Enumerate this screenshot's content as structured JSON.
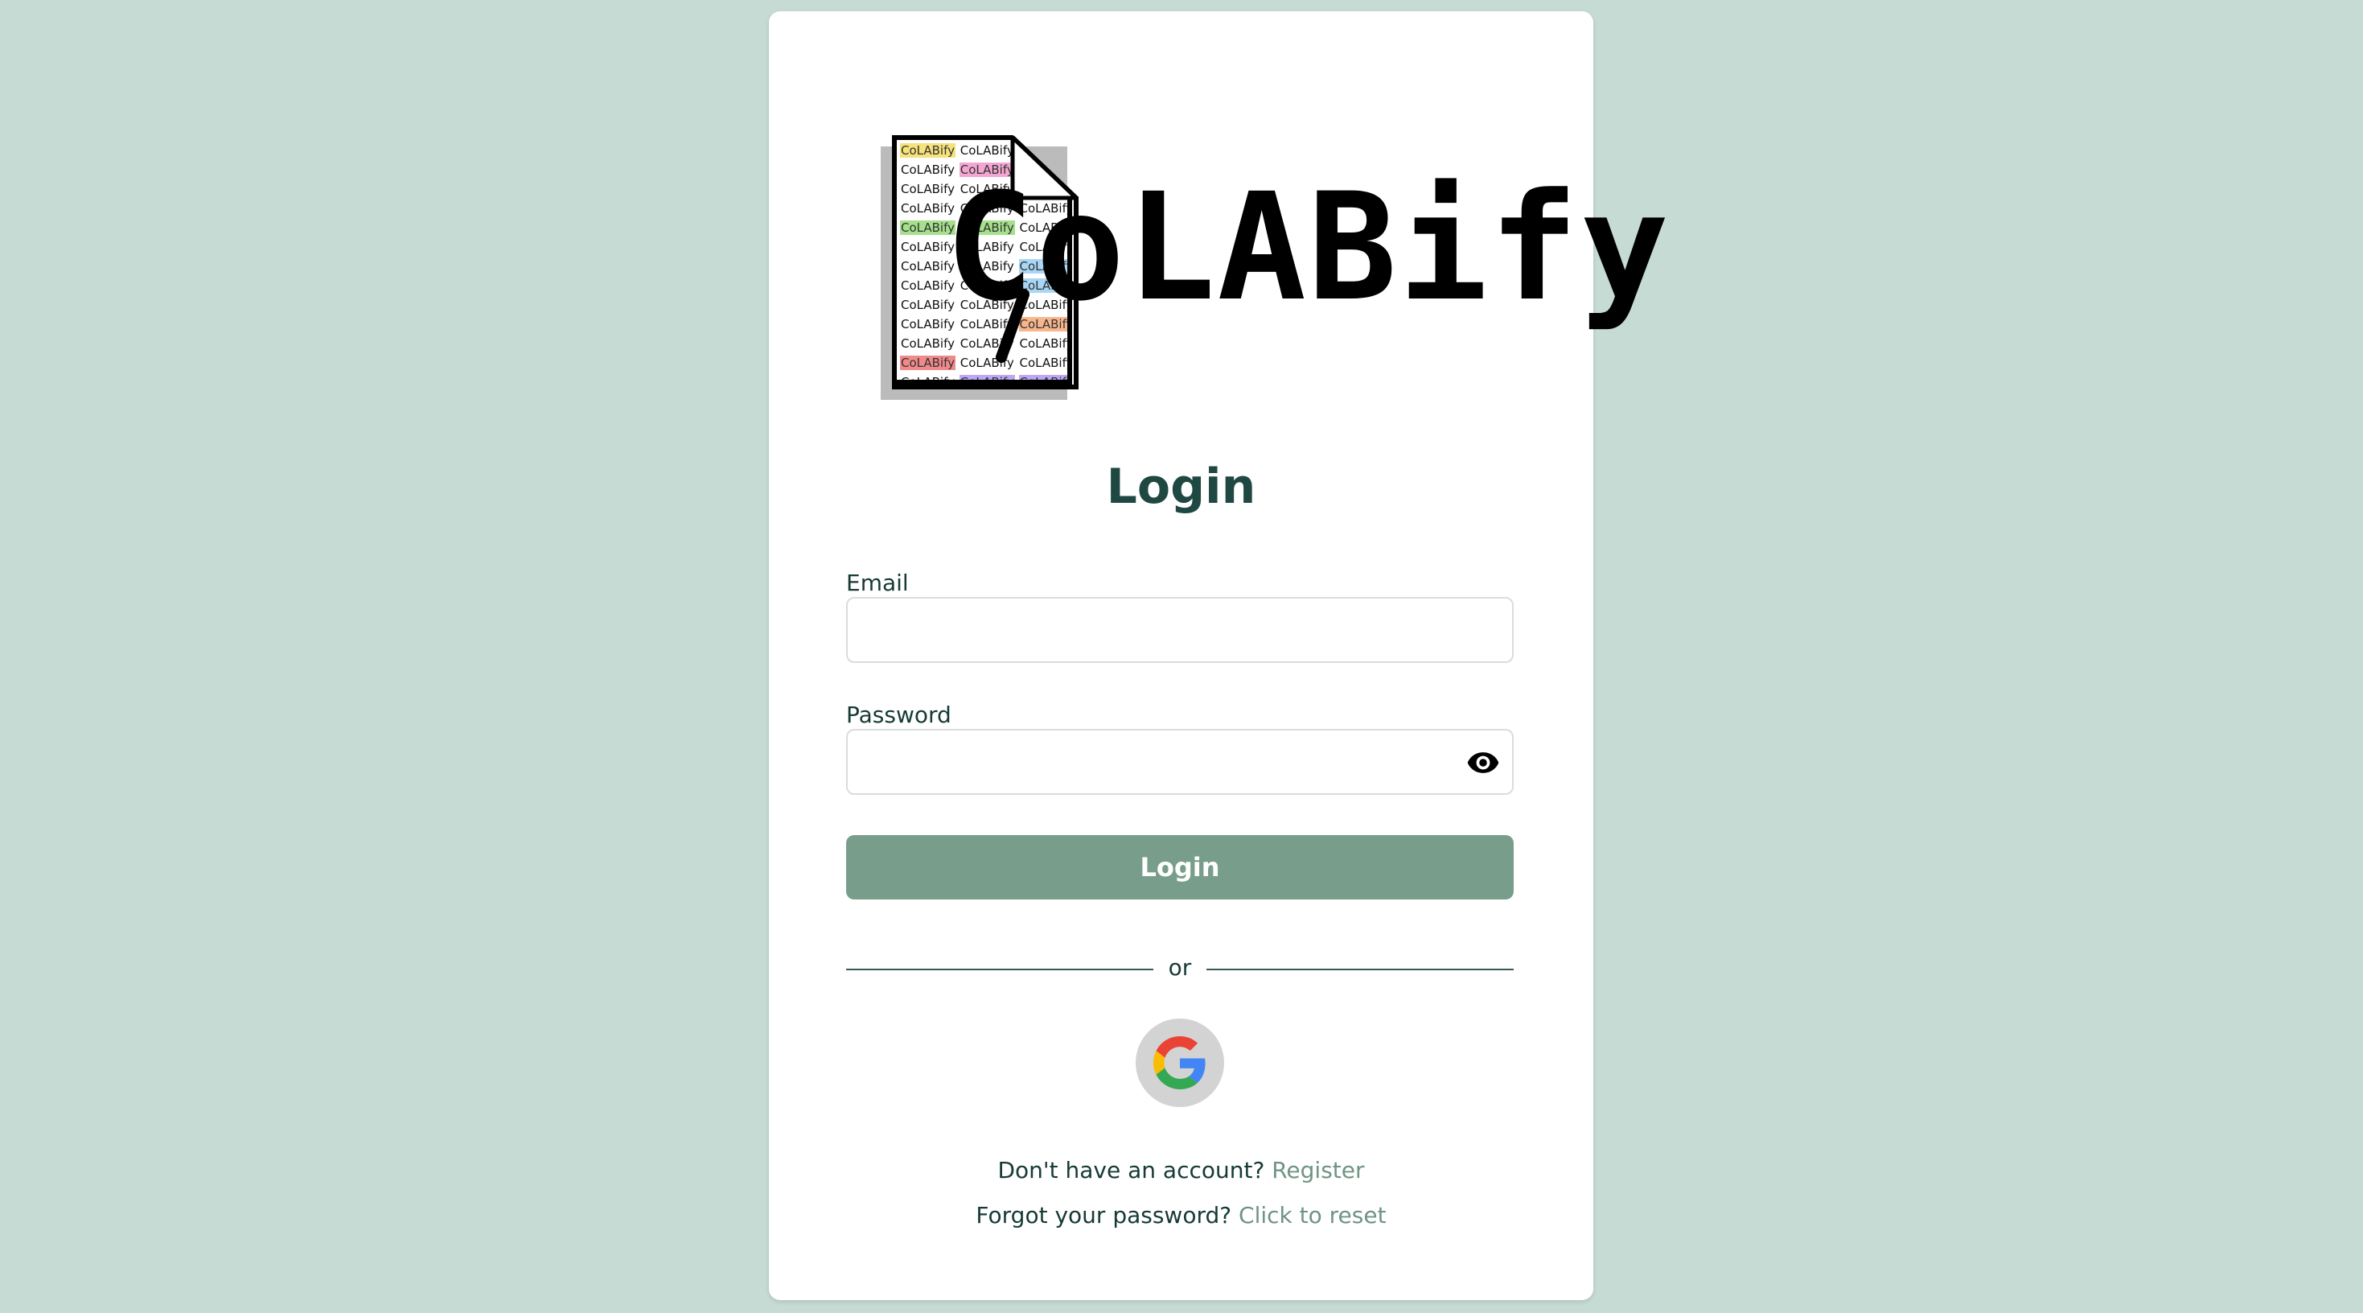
{
  "logo": {
    "text": "CoLABify",
    "doc_word": "CoLABify"
  },
  "form": {
    "title": "Login",
    "email_label": "Email",
    "email_value": "",
    "password_label": "Password",
    "password_value": "",
    "login_button": "Login",
    "divider_text": "or"
  },
  "footer": {
    "register_prompt": "Don't have an account?",
    "register_link": "Register",
    "forgot_prompt": "Forgot your password?",
    "forgot_link": "Click to reset"
  },
  "icons": {
    "password_toggle": "eye-icon",
    "google": "google-icon"
  },
  "colors": {
    "background": "#c6dbd4",
    "primary_button": "#789e8b",
    "link": "#6f9483",
    "title": "#1f4843"
  }
}
